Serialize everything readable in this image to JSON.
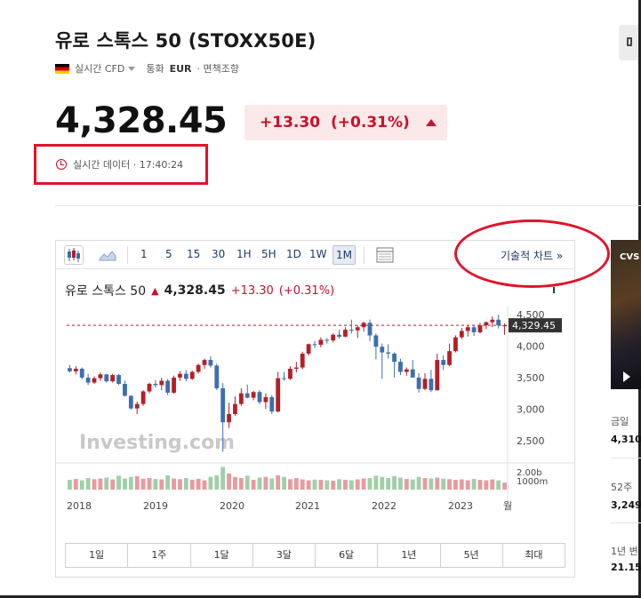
{
  "header": {
    "title": "유로 스톡스 50 (STOXX50E)",
    "type_label": "실시간 CFD",
    "currency_label": "통화",
    "currency": "EUR",
    "exemption": "· 면책조항"
  },
  "quote": {
    "price": "4,328.45",
    "change": "+13.30",
    "change_pct": "(+0.31%)",
    "direction": "up",
    "realtime_label": "실시간 데이터 · 17:40:24"
  },
  "chart_toolbar": {
    "periods": [
      "1",
      "5",
      "15",
      "30",
      "1H",
      "5H",
      "1D",
      "1W",
      "1M"
    ],
    "active_period": "1M",
    "tech_chart_link": "기술적 차트 »"
  },
  "chart_legend": {
    "name": "유로 스톡스 50",
    "price": "4,328.45",
    "change": "+13.30",
    "change_pct": "(+0.31%)"
  },
  "chart_data": {
    "type": "candlestick",
    "watermark": "Investing.com",
    "x_ticks": [
      "2018",
      "2019",
      "2020",
      "2021",
      "2022",
      "2023",
      "월"
    ],
    "y_ticks": [
      "4,500",
      "4,000",
      "3,500",
      "3,000",
      "2,500"
    ],
    "volume_ticks": [
      "2.00b",
      "1000m"
    ],
    "current_label": "4,329.45",
    "ylim": [
      2200,
      4600
    ],
    "colors": {
      "up": "#b3202a",
      "down": "#3d6fae",
      "vol_up": "#e89aa0",
      "vol_down": "#9fcfa8"
    },
    "candles": [
      [
        3650,
        3700,
        3580,
        3600
      ],
      [
        3600,
        3680,
        3550,
        3640
      ],
      [
        3640,
        3660,
        3470,
        3500
      ],
      [
        3500,
        3560,
        3380,
        3420
      ],
      [
        3420,
        3520,
        3400,
        3490
      ],
      [
        3490,
        3580,
        3450,
        3550
      ],
      [
        3550,
        3560,
        3420,
        3440
      ],
      [
        3440,
        3560,
        3420,
        3540
      ],
      [
        3540,
        3560,
        3380,
        3400
      ],
      [
        3400,
        3450,
        3200,
        3210
      ],
      [
        3210,
        3220,
        2990,
        3010
      ],
      [
        3010,
        3120,
        2920,
        3080
      ],
      [
        3080,
        3300,
        3050,
        3280
      ],
      [
        3280,
        3420,
        3250,
        3400
      ],
      [
        3400,
        3460,
        3340,
        3380
      ],
      [
        3380,
        3500,
        3300,
        3450
      ],
      [
        3450,
        3480,
        3220,
        3260
      ],
      [
        3260,
        3530,
        3240,
        3500
      ],
      [
        3500,
        3600,
        3450,
        3560
      ],
      [
        3560,
        3620,
        3440,
        3480
      ],
      [
        3480,
        3610,
        3460,
        3590
      ],
      [
        3590,
        3720,
        3560,
        3700
      ],
      [
        3700,
        3800,
        3640,
        3780
      ],
      [
        3780,
        3840,
        3660,
        3690
      ],
      [
        3690,
        3720,
        3300,
        3330
      ],
      [
        3330,
        3410,
        2320,
        2790
      ],
      [
        2790,
        3100,
        2700,
        2920
      ],
      [
        2920,
        3200,
        2890,
        3080
      ],
      [
        3080,
        3330,
        3050,
        3250
      ],
      [
        3250,
        3390,
        3170,
        3180
      ],
      [
        3180,
        3290,
        3140,
        3270
      ],
      [
        3270,
        3300,
        3080,
        3110
      ],
      [
        3110,
        3250,
        3000,
        3190
      ],
      [
        3190,
        3220,
        2920,
        2960
      ],
      [
        2960,
        3590,
        2950,
        3490
      ],
      [
        3490,
        3590,
        3450,
        3480
      ],
      [
        3480,
        3680,
        3460,
        3640
      ],
      [
        3640,
        3750,
        3580,
        3660
      ],
      [
        3660,
        3910,
        3630,
        3880
      ],
      [
        3880,
        4040,
        3850,
        4030
      ],
      [
        4030,
        4080,
        3970,
        4020
      ],
      [
        4020,
        4140,
        3980,
        4100
      ],
      [
        4100,
        4130,
        4040,
        4090
      ],
      [
        4090,
        4200,
        4060,
        4180
      ],
      [
        4180,
        4260,
        4120,
        4150
      ],
      [
        4150,
        4300,
        4140,
        4260
      ],
      [
        4260,
        4420,
        4200,
        4250
      ],
      [
        4250,
        4330,
        4130,
        4300
      ],
      [
        4300,
        4390,
        4230,
        4370
      ],
      [
        4370,
        4420,
        4080,
        4170
      ],
      [
        4170,
        4200,
        3790,
        3990
      ],
      [
        3990,
        4040,
        3480,
        3900
      ],
      [
        3900,
        4030,
        3800,
        3880
      ],
      [
        3880,
        3900,
        3500,
        3750
      ],
      [
        3750,
        3800,
        3540,
        3590
      ],
      [
        3590,
        3660,
        3530,
        3630
      ],
      [
        3630,
        3780,
        3500,
        3500
      ],
      [
        3500,
        3570,
        3260,
        3320
      ],
      [
        3320,
        3570,
        3300,
        3480
      ],
      [
        3480,
        3620,
        3270,
        3300
      ],
      [
        3300,
        3880,
        3290,
        3780
      ],
      [
        3780,
        3850,
        3620,
        3700
      ],
      [
        3700,
        4040,
        3680,
        3920
      ],
      [
        3920,
        4170,
        3900,
        4140
      ],
      [
        4140,
        4290,
        4110,
        4240
      ],
      [
        4240,
        4330,
        4150,
        4300
      ],
      [
        4300,
        4340,
        4160,
        4220
      ],
      [
        4220,
        4370,
        4200,
        4330
      ],
      [
        4330,
        4390,
        4270,
        4380
      ],
      [
        4380,
        4470,
        4300,
        4420
      ],
      [
        4420,
        4500,
        4280,
        4330
      ],
      [
        4330,
        4360,
        4180,
        4330
      ]
    ],
    "volumes": [
      0.42,
      0.46,
      0.4,
      0.5,
      0.45,
      0.48,
      0.52,
      0.44,
      0.6,
      0.48,
      0.55,
      0.58,
      0.47,
      0.5,
      0.46,
      0.44,
      0.62,
      0.48,
      0.45,
      0.5,
      0.43,
      0.47,
      0.4,
      0.55,
      0.62,
      0.98,
      0.7,
      0.55,
      0.5,
      0.6,
      0.42,
      0.52,
      0.55,
      0.48,
      0.62,
      0.55,
      0.45,
      0.5,
      0.44,
      0.4,
      0.43,
      0.42,
      0.4,
      0.38,
      0.45,
      0.42,
      0.4,
      0.44,
      0.48,
      0.5,
      0.6,
      0.55,
      0.5,
      0.58,
      0.52,
      0.46,
      0.44,
      0.55,
      0.5,
      0.48,
      0.52,
      0.47,
      0.45,
      0.42,
      0.44,
      0.4,
      0.46,
      0.42,
      0.4,
      0.44,
      0.4,
      0.3
    ]
  },
  "range_buttons": [
    "1일",
    "1주",
    "1달",
    "3달",
    "6달",
    "1년",
    "5년",
    "최대"
  ],
  "sidebar": {
    "news_badge": "CVS",
    "stats": [
      {
        "label": "금일",
        "value": "4,310"
      },
      {
        "label": "52주",
        "value": "3,249"
      },
      {
        "label": "1년 변",
        "value": "21.15"
      }
    ]
  }
}
